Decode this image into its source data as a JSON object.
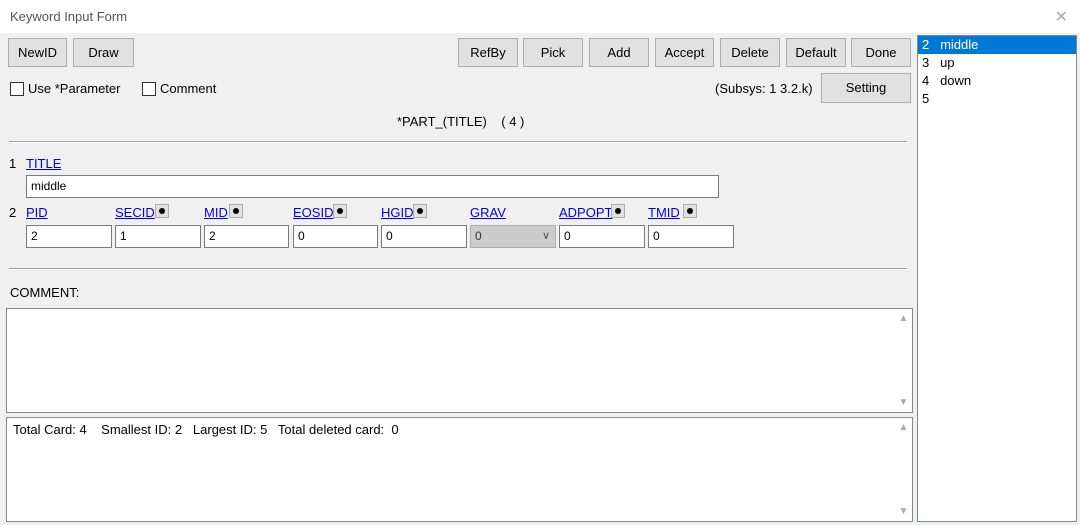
{
  "window": {
    "title": "Keyword Input Form",
    "close_glyph": "✕"
  },
  "toolbar": {
    "newid": "NewID",
    "draw": "Draw",
    "refby": "RefBy",
    "pick": "Pick",
    "add": "Add",
    "accept": "Accept",
    "delete": "Delete",
    "default": "Default",
    "done": "Done",
    "setting": "Setting"
  },
  "options": {
    "use_parameter": "Use *Parameter",
    "comment": "Comment"
  },
  "subsys": "(Subsys: 1 3.2.k)",
  "keyword_header": "*PART_(TITLE)    ( 4 )",
  "row1": {
    "num": "1",
    "title_label": "TITLE",
    "title_value": "middle"
  },
  "row2": {
    "num": "2",
    "fields": [
      {
        "label": "PID",
        "value": "2"
      },
      {
        "label": "SECID",
        "value": "1"
      },
      {
        "label": "MID",
        "value": "2"
      },
      {
        "label": "EOSID",
        "value": "0"
      },
      {
        "label": "HGID",
        "value": "0"
      },
      {
        "label": "GRAV",
        "value": "0"
      },
      {
        "label": "ADPOPT",
        "value": "0"
      },
      {
        "label": "TMID",
        "value": "0"
      }
    ]
  },
  "comment_label": "COMMENT:",
  "comment_text": "",
  "status": "Total Card: 4    Smallest ID: 2   Largest ID: 5   Total deleted card:  0",
  "list": [
    {
      "text": "2   middle",
      "selected": true
    },
    {
      "text": "3   up",
      "selected": false
    },
    {
      "text": "4   down",
      "selected": false
    },
    {
      "text": "5",
      "selected": false
    }
  ],
  "icons": {
    "up": "▲",
    "down": "▼",
    "chevron": "∨"
  }
}
